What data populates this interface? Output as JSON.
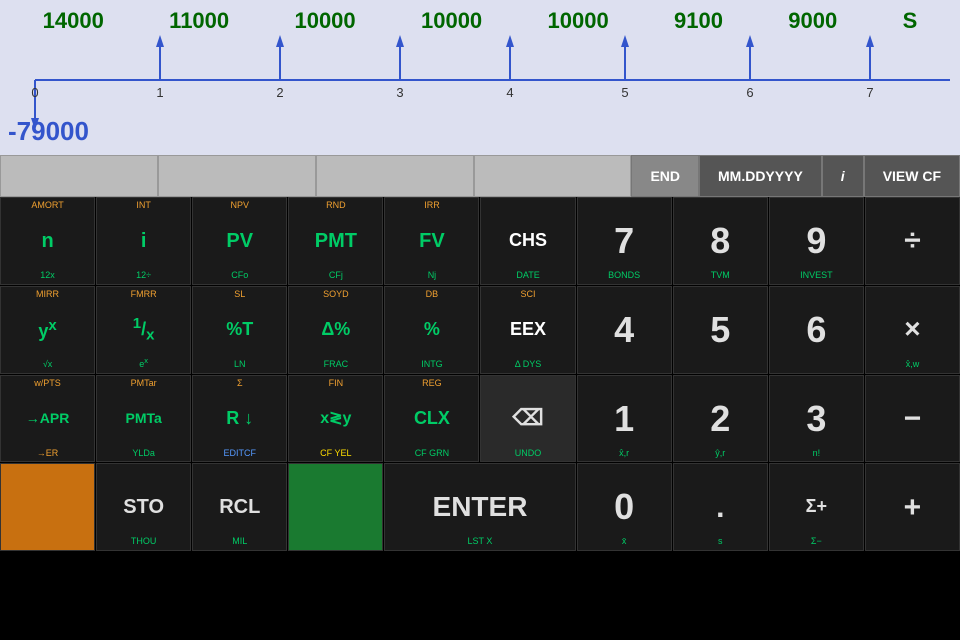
{
  "timeline": {
    "values": [
      "14000",
      "11000",
      "10000",
      "10000",
      "10000",
      "9100",
      "9000",
      "S"
    ],
    "ticks": [
      "0",
      "1",
      "2",
      "3",
      "4",
      "5",
      "6",
      "7"
    ],
    "negative": "-79000"
  },
  "mode_row": {
    "spacers": 4,
    "end_label": "END",
    "date_label": "MM.DDYYYY",
    "i_label": "i",
    "viewcf_label": "VIEW CF"
  },
  "rows": [
    {
      "keys": [
        {
          "top": "AMORT",
          "main": "n",
          "bottom": "12x",
          "id": "n"
        },
        {
          "top": "INT",
          "main": "i",
          "bottom": "12÷",
          "id": "i"
        },
        {
          "top": "NPV",
          "main": "PV",
          "bottom": "CFo",
          "id": "pv"
        },
        {
          "top": "RND",
          "main": "PMT",
          "bottom": "CFj",
          "id": "pmt"
        },
        {
          "top": "IRR",
          "main": "FV",
          "bottom": "Nj",
          "id": "fv"
        },
        {
          "top": "",
          "main": "CHS",
          "bottom": "DATE",
          "id": "chs"
        },
        {
          "top": "",
          "main": "7",
          "bottom": "BONDS",
          "bottom_color": "green",
          "id": "7",
          "numkey": true
        },
        {
          "top": "",
          "main": "8",
          "bottom": "TVM",
          "bottom_color": "green",
          "id": "8",
          "numkey": true
        },
        {
          "top": "",
          "main": "9",
          "bottom": "INVEST",
          "bottom_color": "green",
          "id": "9",
          "numkey": true
        },
        {
          "top": "",
          "main": "÷",
          "bottom": "",
          "id": "div",
          "op": true
        }
      ]
    },
    {
      "keys": [
        {
          "top": "MIRR",
          "main": "yˣ",
          "bottom": "√x",
          "id": "yx"
        },
        {
          "top": "FMRR",
          "main": "¹/ₓ",
          "bottom": "eˣ",
          "id": "onex"
        },
        {
          "top": "SL",
          "main": "%T",
          "bottom": "LN",
          "id": "pct"
        },
        {
          "top": "SOYD",
          "main": "Δ%",
          "bottom": "FRAC",
          "id": "dpct"
        },
        {
          "top": "DB",
          "main": "%",
          "bottom": "INTG",
          "id": "pct2"
        },
        {
          "top": "SCI",
          "main": "EEX",
          "bottom": "Δ DYS",
          "id": "eex"
        },
        {
          "top": "",
          "main": "4",
          "bottom": "",
          "id": "4",
          "numkey": true
        },
        {
          "top": "",
          "main": "5",
          "bottom": "",
          "id": "5",
          "numkey": true
        },
        {
          "top": "",
          "main": "6",
          "bottom": "",
          "id": "6",
          "numkey": true
        },
        {
          "top": "",
          "main": "×",
          "bottom": "x̂,w",
          "id": "mul",
          "op": true
        }
      ]
    },
    {
      "keys": [
        {
          "top": "w/PTS",
          "main": "→APR",
          "bottom": "→ER",
          "id": "apr"
        },
        {
          "top": "PMTar",
          "main": "PMTa",
          "bottom": "YLDa",
          "id": "pmta"
        },
        {
          "top": "Σ",
          "main": "R ↓",
          "bottom": "EDITCF",
          "bottom_color": "blue",
          "id": "rdown"
        },
        {
          "top": "FIN",
          "main": "x≷y",
          "bottom": "CF YEL",
          "bottom_color": "yellow",
          "id": "xswap"
        },
        {
          "top": "REG",
          "main": "CLX",
          "bottom": "CF GRN",
          "bottom_color": "green",
          "id": "clx"
        },
        {
          "top": "",
          "main": "⌫",
          "bottom": "UNDO",
          "id": "bsp",
          "bsp": true
        },
        {
          "top": "",
          "main": "1",
          "bottom": "x̂,r",
          "id": "1",
          "numkey": true
        },
        {
          "top": "",
          "main": "2",
          "bottom": "ŷ,r",
          "id": "2",
          "numkey": true
        },
        {
          "top": "",
          "main": "3",
          "bottom": "n!",
          "id": "3",
          "numkey": true
        },
        {
          "top": "",
          "main": "−",
          "bottom": "",
          "id": "sub",
          "op": true
        }
      ]
    },
    {
      "keys": [
        {
          "top": "",
          "main": "",
          "bottom": "",
          "id": "orange",
          "orange": true
        },
        {
          "top": "",
          "main": "STO",
          "bottom": "THOU",
          "id": "sto"
        },
        {
          "top": "",
          "main": "RCL",
          "bottom": "MIL",
          "id": "rcl"
        },
        {
          "top": "",
          "main": "",
          "bottom": "",
          "id": "green",
          "green": true
        },
        {
          "top": "",
          "main": "ENTER",
          "bottom": "LST X",
          "id": "enter",
          "enter": true
        },
        {
          "top": "",
          "main": "0",
          "bottom": "x̄",
          "id": "0",
          "numkey": true
        },
        {
          "top": "",
          "main": ".",
          "bottom": "s",
          "id": "dot",
          "numkey": true
        },
        {
          "top": "",
          "main": "Σ+",
          "bottom": "Σ−",
          "id": "sigma"
        },
        {
          "top": "",
          "main": "+",
          "bottom": "",
          "id": "add",
          "op": true
        }
      ]
    }
  ]
}
